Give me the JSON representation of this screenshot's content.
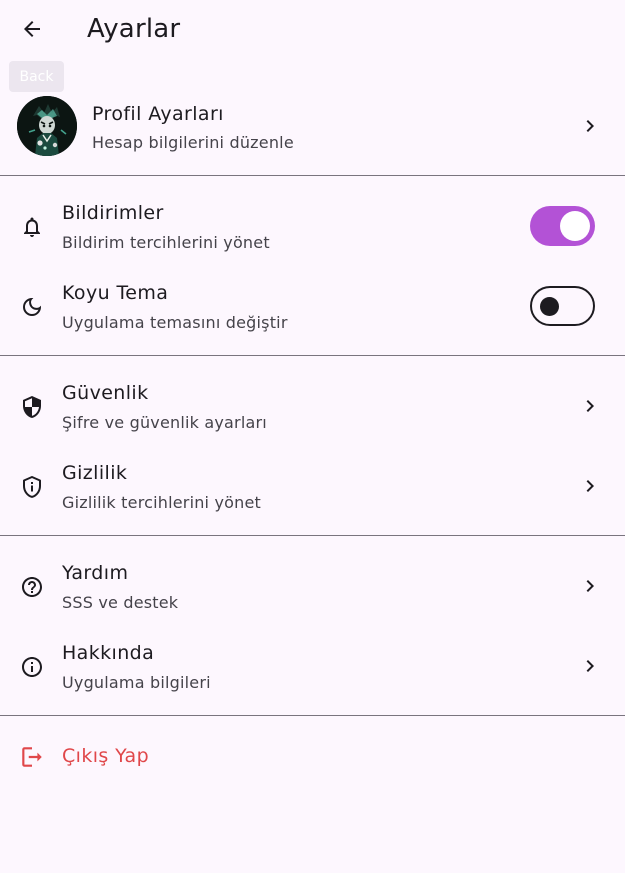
{
  "appbar": {
    "title": "Ayarlar",
    "back_tooltip": "Back"
  },
  "profile": {
    "title": "Profil Ayarları",
    "subtitle": "Hesap bilgilerini düzenle"
  },
  "settings": {
    "notifications": {
      "title": "Bildirimler",
      "subtitle": "Bildirim tercihlerini yönet",
      "enabled": true,
      "icon": "bell-icon"
    },
    "dark_theme": {
      "title": "Koyu Tema",
      "subtitle": "Uygulama temasını değiştir",
      "enabled": false,
      "icon": "moon-icon"
    },
    "security": {
      "title": "Güvenlik",
      "subtitle": "Şifre ve güvenlik ayarları",
      "icon": "shield-icon"
    },
    "privacy": {
      "title": "Gizlilik",
      "subtitle": "Gizlilik tercihlerini yönet",
      "icon": "privacy-shield-icon"
    },
    "help": {
      "title": "Yardım",
      "subtitle": "SSS ve destek",
      "icon": "help-circle-icon"
    },
    "about": {
      "title": "Hakkında",
      "subtitle": "Uygulama bilgileri",
      "icon": "info-icon"
    }
  },
  "logout": {
    "label": "Çıkış Yap",
    "icon": "logout-icon"
  },
  "colors": {
    "background": "#fdf7fe",
    "switch_on": "#b352d6",
    "danger": "#e0474a",
    "divider": "#79747e",
    "text_primary": "#1d1b20",
    "text_secondary": "#45434a"
  }
}
